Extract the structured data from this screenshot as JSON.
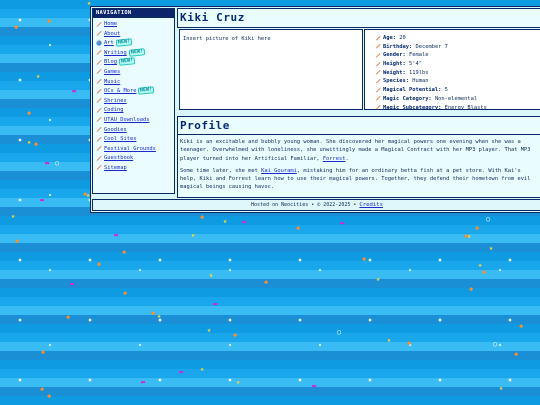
{
  "nav": {
    "title": "NAVIGATION",
    "new_tag": "NEW!",
    "items": [
      {
        "label": "Home",
        "new": false
      },
      {
        "label": "About",
        "new": false
      },
      {
        "label": "Art",
        "new": true
      },
      {
        "label": "Writing",
        "new": true
      },
      {
        "label": "Blog",
        "new": true
      },
      {
        "label": "Games",
        "new": false
      },
      {
        "label": "Music",
        "new": false
      },
      {
        "label": "OCs & More",
        "new": true
      },
      {
        "label": "Shrines",
        "new": false
      },
      {
        "label": "Coding",
        "new": false
      },
      {
        "label": "UTAU Downloads",
        "new": false
      },
      {
        "label": "Goodies",
        "new": false
      },
      {
        "label": "Cool Sites",
        "new": false
      },
      {
        "label": "Festival Grounds",
        "new": false
      },
      {
        "label": "Guestbook",
        "new": false
      },
      {
        "label": "Sitemap",
        "new": false
      }
    ]
  },
  "character": {
    "name": "Kiki Cruz",
    "picture_placeholder": "Insert picture of Kiki here"
  },
  "stats": [
    {
      "label": "Age:",
      "value": "20"
    },
    {
      "label": "Birthday:",
      "value": "December 7"
    },
    {
      "label": "Gender:",
      "value": "Female"
    },
    {
      "label": "Height:",
      "value": "5'4\""
    },
    {
      "label": "Weight:",
      "value": "119lbs"
    },
    {
      "label": "Species:",
      "value": "Human"
    },
    {
      "label": "Magical Potential:",
      "value": "5"
    },
    {
      "label": "Magic Category:",
      "value": "Non-elemental"
    },
    {
      "label": "Magic Subcategory:",
      "value": "Energy Blasts"
    }
  ],
  "profile": {
    "heading": "Profile",
    "p1_a": "Kiki is an excitable and bubbly young woman. She discovered her magical powers one evening when she was a teenager. Overwhelmed with loneliness, she unwittingly made a Magical Contract with her MP3 player. That MP3 player turned into her Artificial Familiar, ",
    "p1_link": "Forrest",
    "p1_b": ".",
    "p2_a": "Some time later, she met ",
    "p2_link": "Kai Gourami",
    "p2_b": ", mistaking him for an ordinary betta fish at a pet store. With Kai's help, Kiki and Forrest learn how to use their magical powers. Together, they defend their hometown from evil magical beings causing havoc."
  },
  "footer": {
    "text": "Hosted on Neocities • © 2022-2025 • ",
    "link": "Credits"
  },
  "colors": {
    "ocean": "#1aa6ea",
    "panel": "#d9f6fb",
    "border": "#0a2a66",
    "link": "#1a2acb",
    "heading": "#062a72"
  }
}
